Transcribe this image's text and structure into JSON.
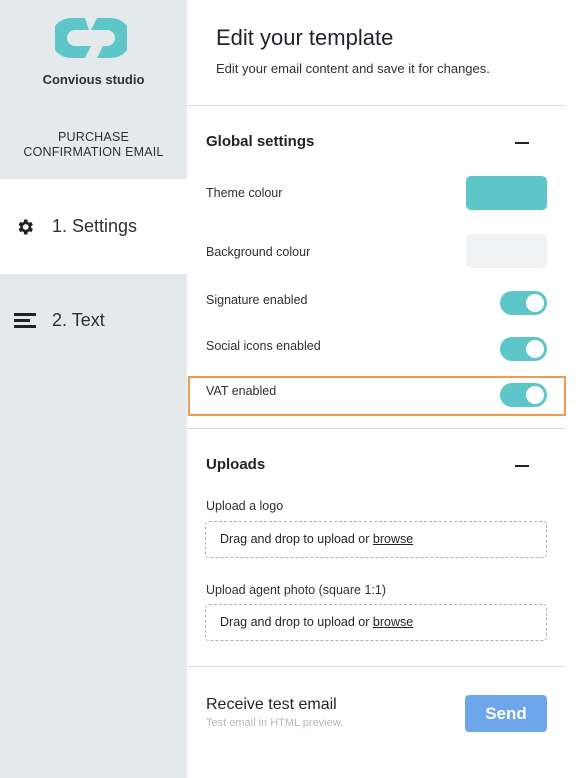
{
  "sidebar": {
    "brand_name": "Convious studio",
    "template_name_line1": "PURCHASE",
    "template_name_line2": "CONFIRMATION EMAIL",
    "items": [
      {
        "label": "1. Settings",
        "icon": "gear-icon",
        "active": true
      },
      {
        "label": "2. Text",
        "icon": "text-lines-icon",
        "active": false
      }
    ]
  },
  "header": {
    "title": "Edit your template",
    "subtitle": "Edit your email content and save it for changes."
  },
  "global_settings": {
    "title": "Global settings",
    "collapse_icon": "minus-icon",
    "theme_colour_label": "Theme colour",
    "theme_colour_value": "#5ec5c8",
    "background_colour_label": "Background colour",
    "background_colour_value": "#f1f2f3",
    "signature_label": "Signature enabled",
    "signature_enabled": true,
    "social_icons_label": "Social icons enabled",
    "social_icons_enabled": true,
    "vat_label": "VAT enabled",
    "vat_enabled": true
  },
  "uploads": {
    "title": "Uploads",
    "collapse_icon": "minus-icon",
    "logo_label": "Upload a logo",
    "logo_drop_text": "Drag and drop to upload or ",
    "logo_browse": "browse",
    "photo_label": "Upload agent photo (square 1:1)",
    "photo_drop_text": "Drag and drop to upload or ",
    "photo_browse": "browse"
  },
  "test_email": {
    "title": "Receive test email",
    "subtitle": "Test email in HTML preview.",
    "send_label": "Send"
  },
  "colors": {
    "accent": "#5ec5c8",
    "send_button": "#6ea6ec",
    "highlight_border": "#ef9a52",
    "sidebar_bg": "#e4e9ec"
  }
}
